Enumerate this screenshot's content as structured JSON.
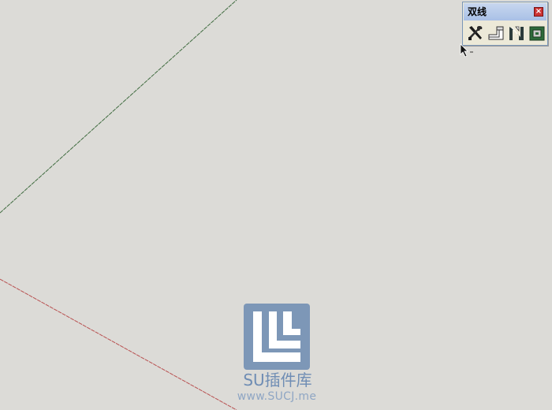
{
  "toolbar": {
    "title": "双线",
    "close_label": "×",
    "buttons": [
      {
        "icon": "settings-tools-icon"
      },
      {
        "icon": "double-line-icon"
      },
      {
        "icon": "double-line-offset-icon"
      },
      {
        "icon": "double-line-close-icon"
      }
    ]
  },
  "viewport": {
    "background": "#dcdbd7",
    "green_axis_color": "#3f6b3f",
    "red_axis_color": "#b85050"
  },
  "watermark": {
    "title": "SU插件库",
    "url": "www.SUCJ.me",
    "color": "#7d97b7"
  }
}
